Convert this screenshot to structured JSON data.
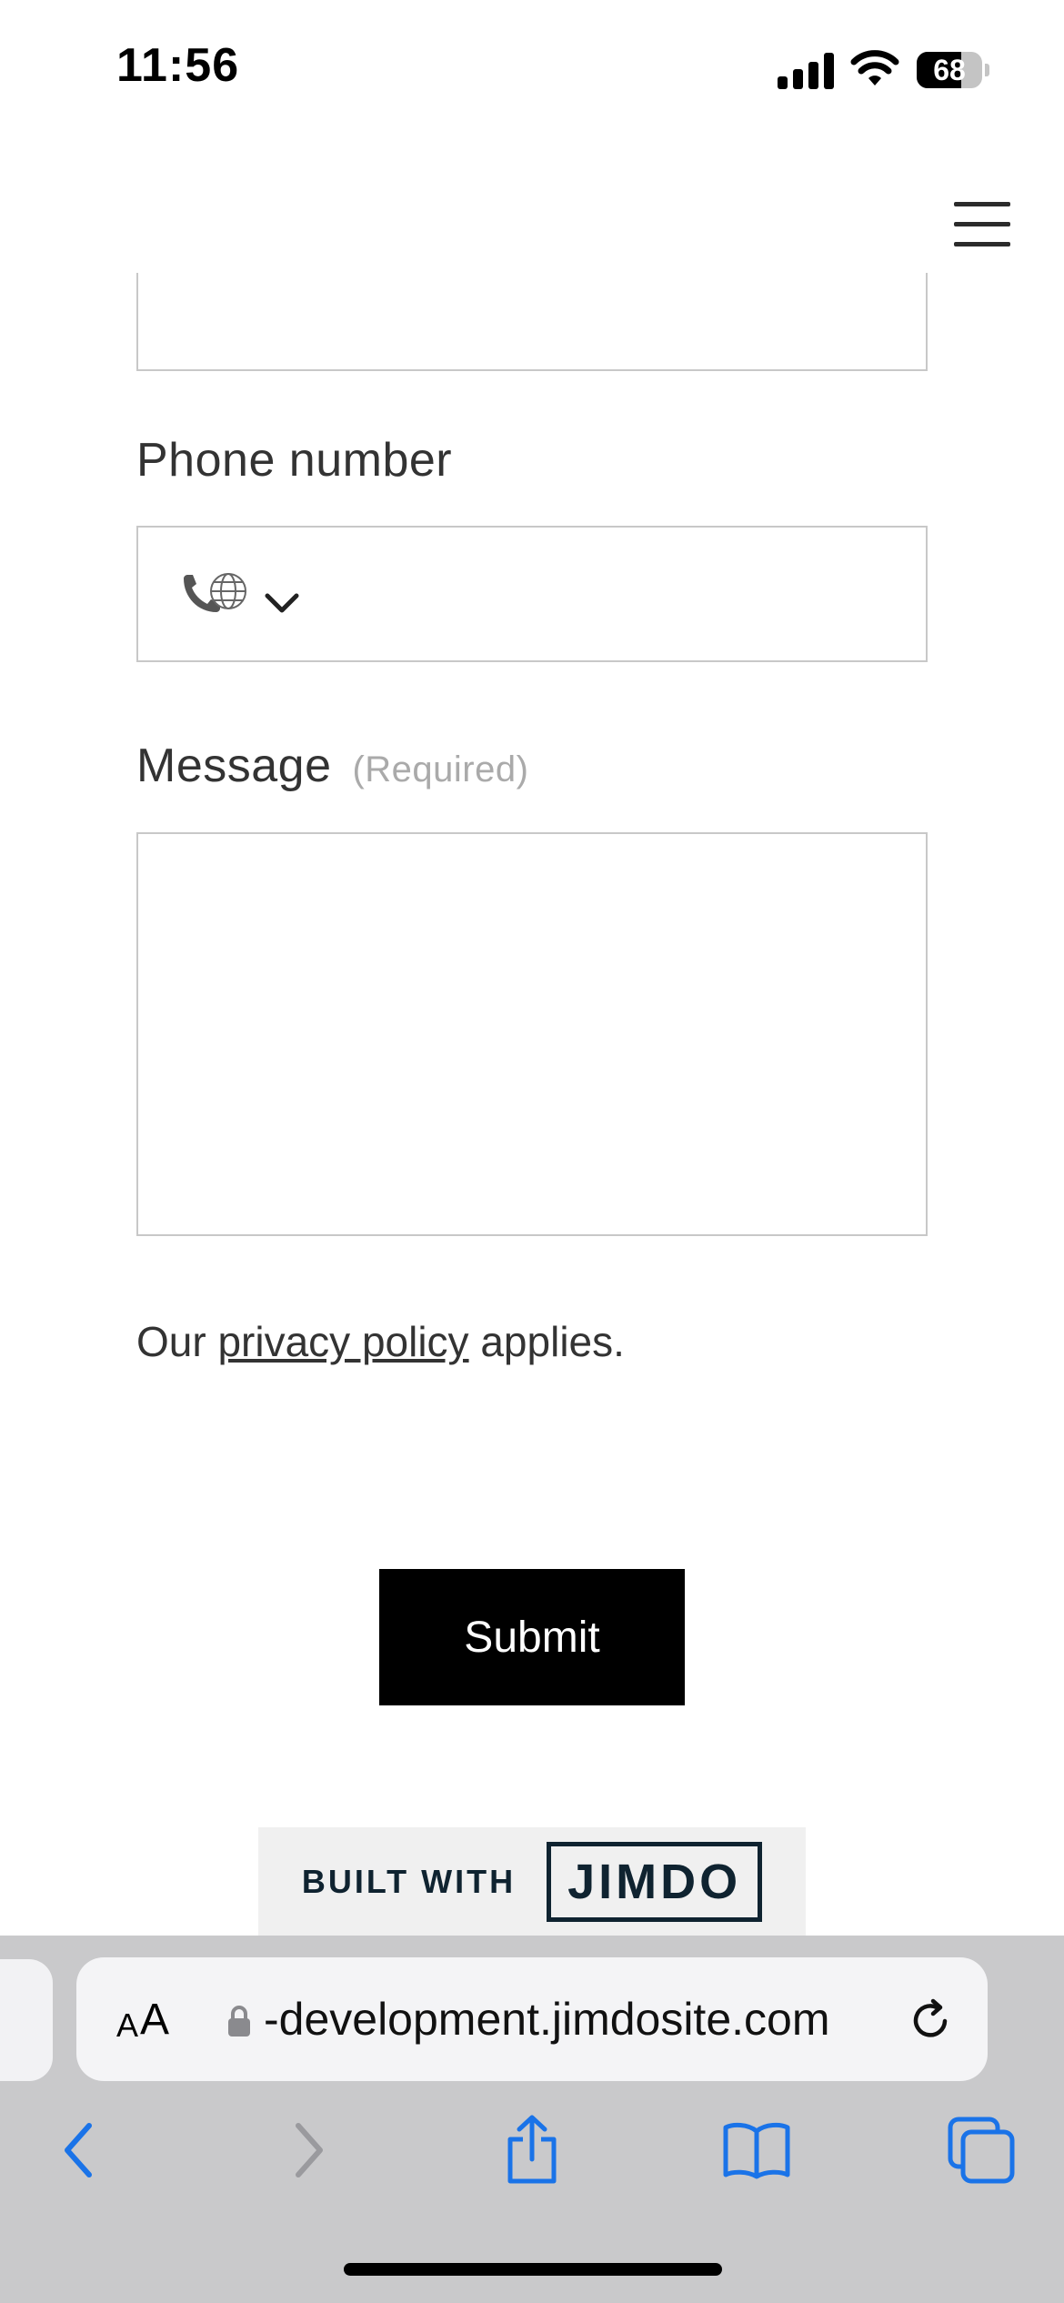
{
  "status_bar": {
    "time": "11:56",
    "battery_percent": "68",
    "battery_level": 0.68
  },
  "header": {
    "menu_icon": "hamburger-menu-icon"
  },
  "form": {
    "phone_label": "Phone number",
    "phone_prefix_icon": "phone-globe-icon",
    "phone_prefix_dropdown_icon": "chevron-down-icon",
    "phone_value": "",
    "message_label": "Message",
    "message_required": "(Required)",
    "message_value": "",
    "privacy_prefix": "Our",
    "privacy_link": "privacy policy",
    "privacy_suffix": "applies.",
    "submit_label": "Submit"
  },
  "badge": {
    "built_with": "BUILT WITH",
    "brand": "JIMDO"
  },
  "safari": {
    "aa_small": "A",
    "aa_large": "A",
    "url": "-development.jimdosite.com",
    "lock_icon": "lock-icon",
    "reload_icon": "reload-icon",
    "toolbar_icons": [
      "back-icon",
      "forward-icon",
      "share-icon",
      "bookmarks-icon",
      "tabs-icon"
    ],
    "accent_color": "#1a73e8"
  }
}
